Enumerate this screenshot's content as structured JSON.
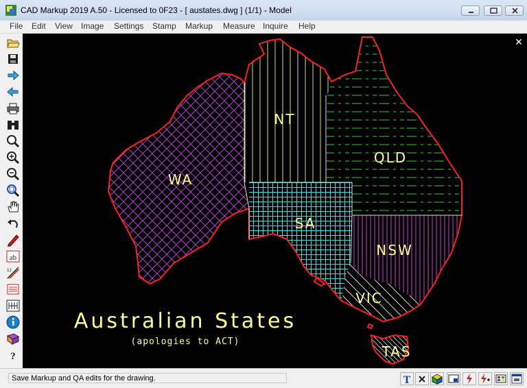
{
  "window": {
    "title": "CAD Markup 2019 A.50 - Licensed to 0F23  -  [ austates.dwg ] (1/1)  -  Model"
  },
  "menu": [
    "File",
    "Edit",
    "View",
    "Image",
    "Settings",
    "Stamp",
    "Markup",
    "Measure",
    "Inquire",
    "Help"
  ],
  "toolbar": [
    "open-folder-icon",
    "save-icon",
    "forward-arrow-icon",
    "back-arrow-icon",
    "print-icon",
    "binoculars-icon",
    "zoom-icon",
    "zoom-in-icon",
    "zoom-out-icon",
    "zoom-window-icon",
    "pan-hand-icon",
    "undo-icon",
    "pen-icon",
    "text-ab-icon",
    "dimension-icon",
    "layers-icon",
    "measure-icon",
    "info-icon",
    "book-icon",
    "help-icon"
  ],
  "drawing": {
    "states": [
      "WA",
      "NT",
      "QLD",
      "SA",
      "NSW",
      "VIC",
      "TAS"
    ],
    "title": "Australian States",
    "subtitle": "(apologies to ACT)",
    "colors": {
      "outline": "#ff2020",
      "wa": "#b040d0",
      "nt": "#e0e070",
      "qld": "#20b020",
      "sa": "#40e0e0",
      "nsw": "#d040d0",
      "vic": "#e0e0e0",
      "label": "#ffff90"
    }
  },
  "status": {
    "message": "Save Markup and QA edits for the drawing."
  },
  "statusbar_buttons": [
    "text-t-icon",
    "cross-icon",
    "cube-icon",
    "window-icon",
    "lightning-icon",
    "lightning-plus-icon",
    "color-palette-icon",
    "printer-window-icon"
  ]
}
